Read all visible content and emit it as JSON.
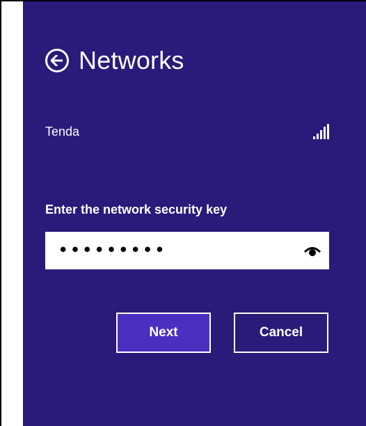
{
  "header": {
    "title": "Networks",
    "back_icon": "back-arrow-icon"
  },
  "network": {
    "name": "Tenda",
    "signal_icon": "wifi-signal-icon",
    "signal_bars": 5
  },
  "security": {
    "label": "Enter the network security key",
    "value": "•••••••••",
    "reveal_icon": "eye-icon"
  },
  "buttons": {
    "next": "Next",
    "cancel": "Cancel"
  },
  "colors": {
    "panel_bg": "#2a1a7a",
    "primary_button": "#4a2fc0",
    "text": "#ffffff"
  }
}
